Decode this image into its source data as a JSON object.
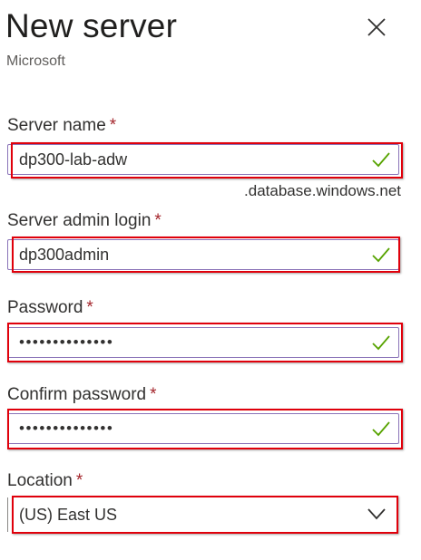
{
  "panel": {
    "title": "New server",
    "subtitle": "Microsoft",
    "close_icon": "close-icon"
  },
  "form": {
    "required_marker": "*",
    "server_name": {
      "label": "Server name",
      "value": "dp300-lab-adw",
      "suffix": ".database.windows.net",
      "valid": true
    },
    "admin_login": {
      "label": "Server admin login",
      "value": "dp300admin",
      "valid": true
    },
    "password": {
      "label": "Password",
      "value": "••••••••••••••",
      "valid": true
    },
    "confirm_password": {
      "label": "Confirm password",
      "value": "••••••••••••••",
      "valid": true
    },
    "location": {
      "label": "Location",
      "value": "(US) East US",
      "dropdown_icon": "chevron-down-icon"
    }
  },
  "colors": {
    "required": "#a4262c",
    "valid_check": "#57a300",
    "input_border": "#8a73b8",
    "highlight": "#e0000b"
  }
}
